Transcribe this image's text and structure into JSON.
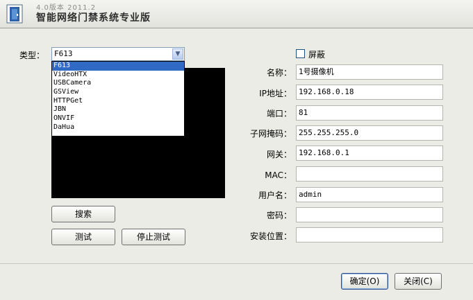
{
  "window": {
    "version": "4.0版本 2011.2",
    "title": "智能网络门禁系统专业版",
    "icon": "door-icon"
  },
  "type_label": "类型：",
  "type_select": {
    "value": "F613",
    "options": [
      "F613",
      "VideoHTX",
      "USBCamera",
      "GSView",
      "HTTPGet",
      "JBN",
      "ONVIF",
      "DaHua"
    ],
    "selected_index": 0
  },
  "buttons": {
    "search": "搜索",
    "test": "测试",
    "stop_test": "停止测试",
    "ok": "确定(O)",
    "close": "关闭(C)"
  },
  "mask_label": "屏蔽",
  "fields": {
    "name": {
      "label": "名称：",
      "value": "1号摄像机"
    },
    "ip": {
      "label": "IP地址：",
      "value": "192.168.0.18"
    },
    "port": {
      "label": "端口：",
      "value": "81"
    },
    "subnet": {
      "label": "子网掩码：",
      "value": "255.255.255.0"
    },
    "gateway": {
      "label": "网关：",
      "value": "192.168.0.1"
    },
    "mac": {
      "label": "MAC：",
      "value": ""
    },
    "username": {
      "label": "用户名：",
      "value": "admin"
    },
    "password": {
      "label": "密码：",
      "value": ""
    },
    "location": {
      "label": "安装位置：",
      "value": ""
    }
  },
  "colors": {
    "window_bg": "#ecece7",
    "selection": "#316ac5",
    "video_bg": "#000000"
  }
}
